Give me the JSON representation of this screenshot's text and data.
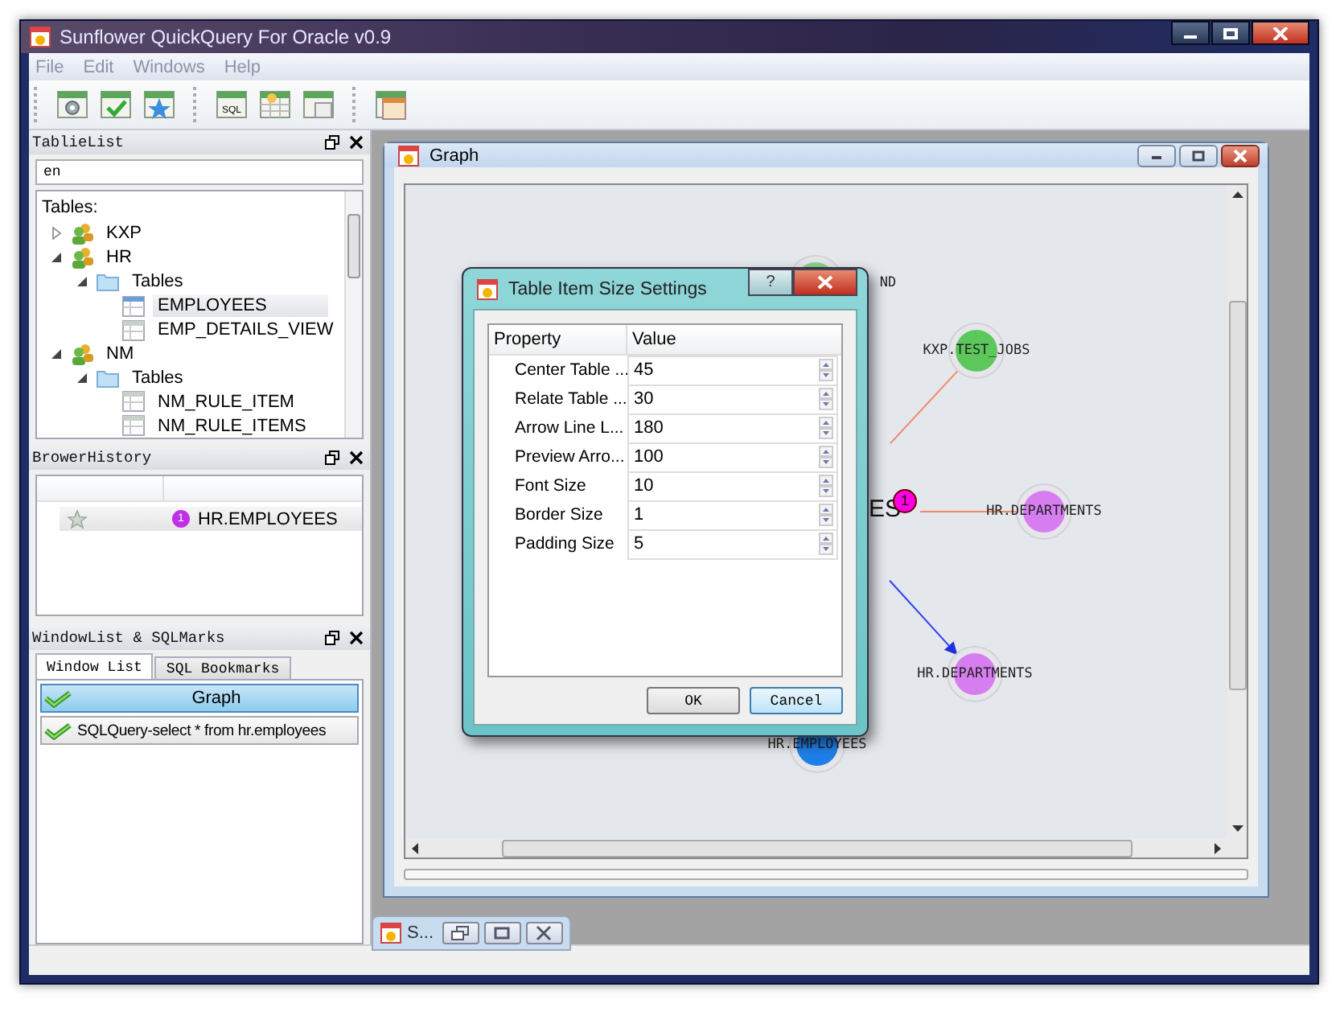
{
  "window": {
    "title": "Sunflower QuickQuery For Oracle v0.9"
  },
  "menu": [
    "File",
    "Edit",
    "Windows",
    "Help"
  ],
  "toolbar": [
    [
      {
        "kind": "settings"
      },
      {
        "kind": "check"
      },
      {
        "kind": "star"
      }
    ],
    [
      {
        "kind": "sql",
        "text": "SQL"
      },
      {
        "kind": "new"
      },
      {
        "kind": "view"
      }
    ],
    [
      {
        "kind": "windows"
      }
    ]
  ],
  "table_list": {
    "title": "TablieList",
    "search": {
      "value": "en"
    },
    "heading": "Tables:",
    "tree": [
      {
        "label": "KXP",
        "kind": "schema",
        "expanded": false,
        "selected": false
      },
      {
        "label": "HR",
        "kind": "schema",
        "expanded": true,
        "selected": false,
        "children": [
          {
            "label": "Tables",
            "kind": "folder",
            "expanded": true,
            "selected": false,
            "children": [
              {
                "label": "EMPLOYEES",
                "kind": "table",
                "selected": true
              },
              {
                "label": "EMP_DETAILS_VIEW",
                "kind": "table",
                "selected": false
              }
            ]
          }
        ]
      },
      {
        "label": "NM",
        "kind": "schema",
        "expanded": true,
        "selected": false,
        "children": [
          {
            "label": "Tables",
            "kind": "folder",
            "expanded": true,
            "selected": false,
            "children": [
              {
                "label": "NM_RULE_ITEM",
                "kind": "table",
                "selected": false
              },
              {
                "label": "NM_RULE_ITEMS",
                "kind": "table",
                "selected": false
              }
            ]
          }
        ]
      }
    ]
  },
  "browser_history": {
    "title": "BrowerHistory",
    "rows": [
      {
        "badge": "1",
        "name": "HR.EMPLOYEES"
      }
    ]
  },
  "window_list": {
    "title": "WindowList & SQLMarks",
    "tabs": [
      {
        "label": "Window List",
        "selected": true
      },
      {
        "label": "SQL Bookmarks",
        "selected": false
      }
    ],
    "items": [
      {
        "label": "Graph",
        "selected": true
      },
      {
        "label": "SQLQuery-select * from hr.employees",
        "selected": false
      }
    ]
  },
  "graph": {
    "title": "Graph",
    "center_label": "ES",
    "center_badge": "1",
    "nodes": [
      {
        "label": "ND",
        "color": "#8ccf8c",
        "kind": "plain"
      },
      {
        "label": "KXP.TEST_JOBS",
        "color": "#5cc85c",
        "kind": "relate"
      },
      {
        "label": "HR.DEPARTMENTS",
        "color": "#d67ef0",
        "kind": "relate"
      },
      {
        "label": "HR.DEPARTMENTS",
        "color": "#d67ef0",
        "kind": "preview"
      },
      {
        "label": "HR.EMPLOYEES",
        "color": "#1e7fe8",
        "kind": "plain"
      }
    ]
  },
  "dialog": {
    "title": "Table Item Size Settings",
    "help": "?",
    "columns": [
      "Property",
      "Value"
    ],
    "rows": [
      {
        "property": "Center Table ...",
        "value": "45"
      },
      {
        "property": "Relate Table ...",
        "value": "30"
      },
      {
        "property": "Arrow Line L...",
        "value": "180"
      },
      {
        "property": "Preview Arro...",
        "value": "100"
      },
      {
        "property": "Font Size",
        "value": "10"
      },
      {
        "property": "Border Size",
        "value": "1"
      },
      {
        "property": "Padding Size",
        "value": "5"
      }
    ],
    "buttons": [
      {
        "label": "OK",
        "kind": "normal"
      },
      {
        "label": "Cancel",
        "kind": "default"
      }
    ]
  },
  "minimized": {
    "title": "S..."
  }
}
